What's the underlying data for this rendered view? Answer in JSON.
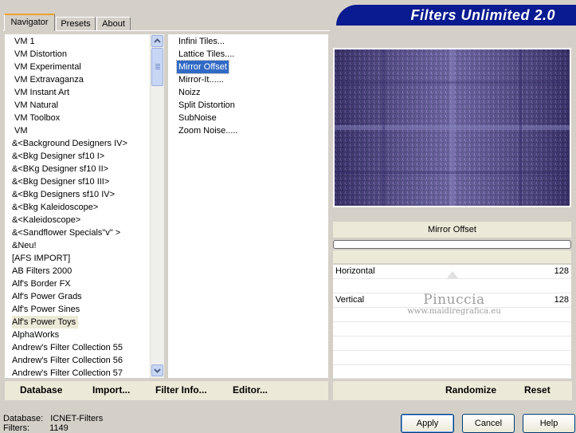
{
  "tabs": [
    {
      "label": "Navigator",
      "active": true
    },
    {
      "label": "Presets",
      "active": false
    },
    {
      "label": "About",
      "active": false
    }
  ],
  "title": "Filters Unlimited 2.0",
  "categories": [
    "VM 1",
    "VM Distortion",
    "VM Experimental",
    "VM Extravaganza",
    "VM Instant Art",
    "VM Natural",
    "VM Toolbox",
    "VM",
    "&<Background Designers IV>",
    "&<Bkg Designer sf10 I>",
    "&<BKg Designer sf10 II>",
    "&<Bkg Designer sf10 III>",
    "&<Bkg Designers sf10 IV>",
    "&<Bkg Kaleidoscope>",
    "&<Kaleidoscope>",
    "&<Sandflower Specials\"v\" >",
    "&Neu!",
    "[AFS IMPORT]",
    "AB Filters 2000",
    "Alf's Border FX",
    "Alf's Power Grads",
    "Alf's Power Sines",
    "Alf's Power Toys",
    "AlphaWorks",
    "Andrew's Filter Collection 55",
    "Andrew's Filter Collection 56",
    "Andrew's Filter Collection 57"
  ],
  "selected_category": "Alf's Power Toys",
  "filters": [
    "Infini Tiles...",
    "Lattice Tiles....",
    "Mirror Offset",
    "Mirror-It......",
    "Noizz",
    "Split Distortion",
    "SubNoise",
    "Zoom Noise....."
  ],
  "selected_filter": "Mirror Offset",
  "bottom_links": {
    "database": "Database",
    "import": "Import...",
    "filter_info": "Filter Info...",
    "editor": "Editor..."
  },
  "right_actions": {
    "randomize": "Randomize",
    "reset": "Reset"
  },
  "filter_label": "Mirror Offset",
  "params": [
    {
      "label": "Horizontal",
      "value": "128"
    },
    {
      "label": "Vertical",
      "value": "128"
    }
  ],
  "watermark": {
    "line1": "Pinuccia",
    "line2": "www.maidiregrafica.eu"
  },
  "buttons": {
    "apply": "Apply",
    "cancel": "Cancel",
    "help": "Help"
  },
  "status": {
    "database_label": "Database:",
    "database_value": "ICNET-Filters",
    "filters_label": "Filters:",
    "filters_value": "1149"
  },
  "colors": {
    "banner": "#0a1a90",
    "selection": "#316ac5",
    "panel": "#ece9d8"
  }
}
